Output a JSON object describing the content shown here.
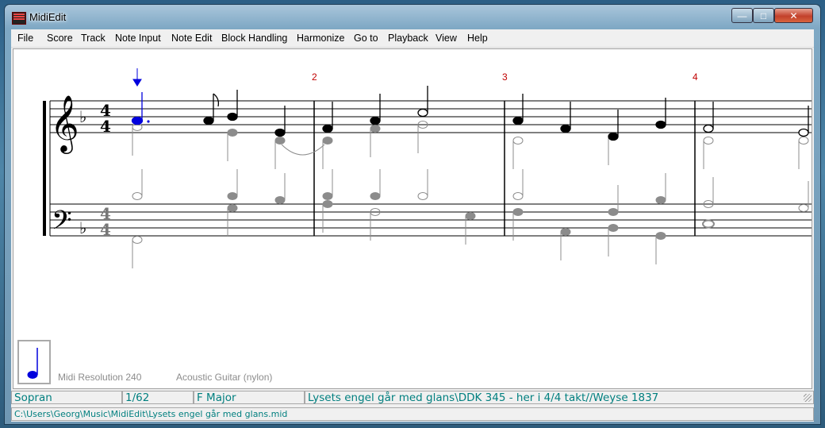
{
  "window": {
    "title": "MidiEdit"
  },
  "menu": [
    "File",
    "Score",
    "Track",
    "Note Input",
    "Note Edit",
    "Block Handling",
    "Harmonize",
    "Go to",
    "Playback",
    "View",
    "Help"
  ],
  "score": {
    "bar_numbers": [
      "2",
      "3",
      "4"
    ],
    "time_signature": {
      "top": "4",
      "bottom": "4"
    },
    "key_flat": "♭"
  },
  "info": {
    "midi_resolution": "Midi Resolution 240",
    "instrument": "Acoustic Guitar (nylon)"
  },
  "status": {
    "track": "Sopran",
    "position": "1/62",
    "key": "F Major",
    "title": "Lysets engel går med glans\\DDK 345 - her i 4/4 takt//Weyse 1837"
  },
  "file_path": "C:\\Users\\Georg\\Music\\MidiEdit\\Lysets engel går med glans.mid",
  "colors": {
    "status_text": "#007f7f",
    "bar_number": "#c00000",
    "cursor": "#0000dd",
    "accompaniment": "#8c8c8c"
  }
}
